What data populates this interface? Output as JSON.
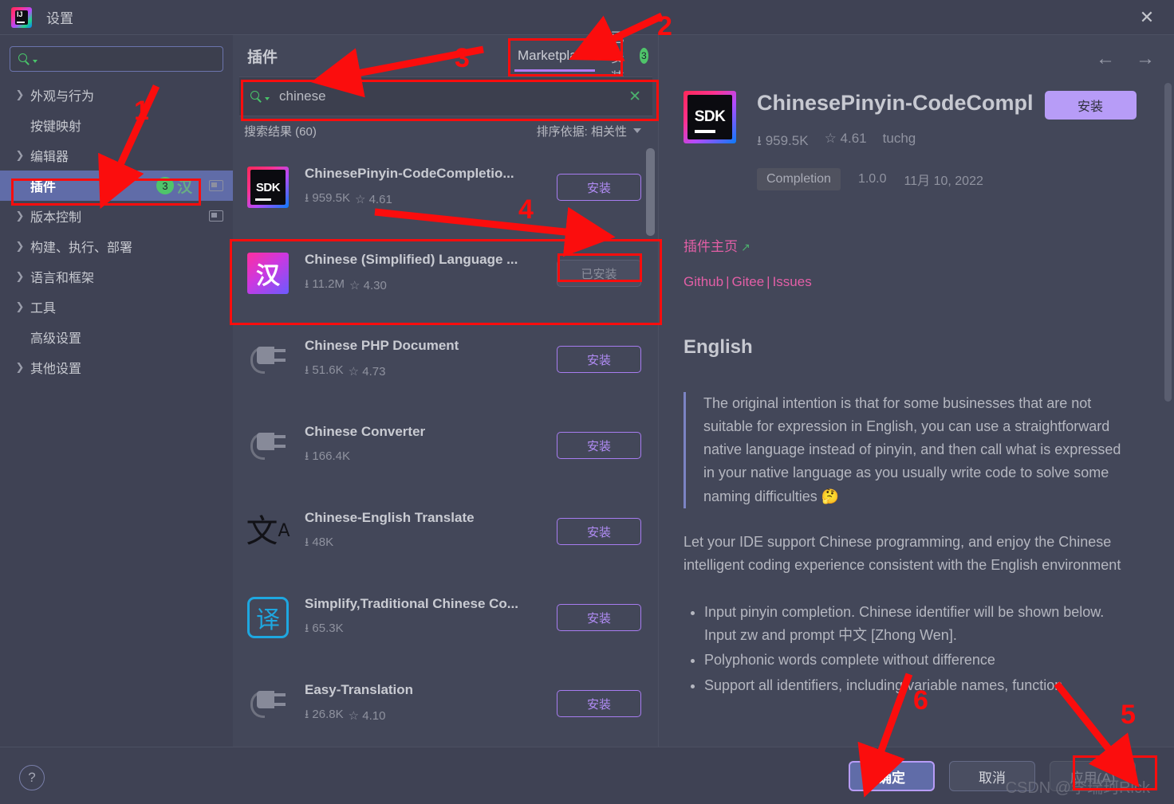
{
  "window": {
    "title": "设置",
    "app_icon": "intellij-idea-icon",
    "close_icon": "close-icon"
  },
  "sidebar": {
    "search_placeholder": "",
    "search_icon": "search-icon",
    "items": [
      {
        "label": "外观与行为",
        "expandable": true,
        "selected": false
      },
      {
        "label": "按键映射",
        "expandable": false,
        "selected": false
      },
      {
        "label": "编辑器",
        "expandable": true,
        "selected": false
      },
      {
        "label": "插件",
        "expandable": false,
        "selected": true,
        "badge": "3"
      },
      {
        "label": "版本控制",
        "expandable": true,
        "selected": false
      },
      {
        "label": "构建、执行、部署",
        "expandable": true,
        "selected": false
      },
      {
        "label": "语言和框架",
        "expandable": true,
        "selected": false
      },
      {
        "label": "工具",
        "expandable": true,
        "selected": false
      },
      {
        "label": "高级设置",
        "expandable": false,
        "selected": false
      },
      {
        "label": "其他设置",
        "expandable": true,
        "selected": false
      }
    ]
  },
  "center": {
    "page_title": "插件",
    "tabs": [
      {
        "label": "Marketplace",
        "active": true,
        "count": ""
      },
      {
        "label": "已安装",
        "active": false,
        "count": "3"
      }
    ],
    "gear_icon": "gear-icon",
    "search": {
      "value": "chinese",
      "placeholder": "",
      "search_icon": "search-icon",
      "clear_icon": "clear-icon"
    },
    "results_label": "搜索结果 (60)",
    "sort_label": "排序依据: 相关性",
    "plugins": [
      {
        "name": "ChinesePinyin-CodeCompletio...",
        "downloads": "959.5K",
        "rating": "4.61",
        "icon": "sdk-icon",
        "action_label": "安装",
        "installed": false
      },
      {
        "name": "Chinese (Simplified) Language ...",
        "downloads": "11.2M",
        "rating": "4.30",
        "icon": "han-character-icon",
        "action_label": "已安装",
        "installed": true
      },
      {
        "name": "Chinese PHP Document",
        "downloads": "51.6K",
        "rating": "4.73",
        "icon": "plug-icon",
        "action_label": "安装",
        "installed": false
      },
      {
        "name": "Chinese Converter",
        "downloads": "166.4K",
        "rating": "",
        "icon": "plug-icon",
        "action_label": "安装",
        "installed": false
      },
      {
        "name": "Chinese-English Translate",
        "downloads": "48K",
        "rating": "",
        "icon": "translate-icon",
        "action_label": "安装",
        "installed": false
      },
      {
        "name": "Simplify,Traditional Chinese Co...",
        "downloads": "65.3K",
        "rating": "",
        "icon": "yi-character-icon",
        "action_label": "安装",
        "installed": false
      },
      {
        "name": "Easy-Translation",
        "downloads": "26.8K",
        "rating": "4.10",
        "icon": "plug-icon",
        "action_label": "安装",
        "installed": false
      }
    ]
  },
  "detail": {
    "icon": "sdk-icon",
    "title": "ChinesePinyin-CodeCompl",
    "install_label": "安装",
    "downloads": "959.5K",
    "rating": "4.61",
    "vendor": "tuchg",
    "tag": "Completion",
    "version": "1.0.0",
    "date": "11月 10, 2022",
    "homepage_label": "插件主页",
    "homepage_arrow_icon": "external-link-icon",
    "links": [
      "Github",
      "Gitee",
      "Issues"
    ],
    "section_title": "English",
    "quote": "The original intention is that for some businesses that are not suitable for expression in English, you can use a straightforward native language instead of pinyin, and then call what is expressed in your native language as you usually write code to solve some naming difficulties 🤔",
    "paragraph": "Let your IDE support Chinese programming, and enjoy the Chinese intelligent coding experience consistent with the English environment",
    "bullets": [
      "Input pinyin completion. Chinese identifier will be shown below. Input zw and prompt 中文 [Zhong Wen].",
      "Polyphonic words complete without difference",
      "Support all identifiers, including variable names, function"
    ]
  },
  "nav": {
    "back_icon": "arrow-left-icon",
    "forward_icon": "arrow-right-icon"
  },
  "footer": {
    "help_icon": "help-icon",
    "ok_label": "确定",
    "cancel_label": "取消",
    "apply_label": "应用(A)",
    "watermark": "CSDN @李瑞珂Rick"
  },
  "annotations": {
    "numbers": [
      "1",
      "2",
      "3",
      "4",
      "5",
      "6"
    ],
    "color": "#fb0d0d"
  }
}
